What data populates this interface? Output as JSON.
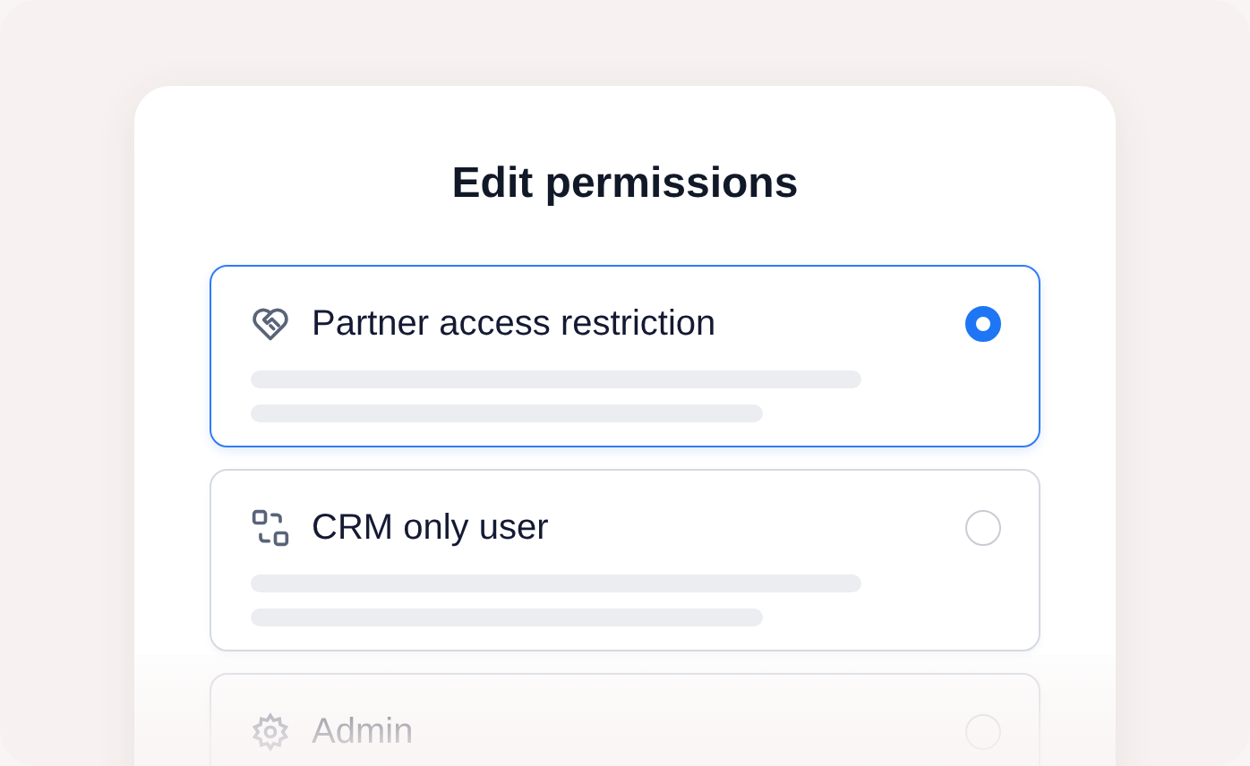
{
  "title": "Edit permissions",
  "options": [
    {
      "label": "Partner access restriction",
      "selected": true,
      "kind": "full"
    },
    {
      "label": "CRM only user",
      "selected": false,
      "kind": "full"
    },
    {
      "label": "Admin",
      "selected": false,
      "kind": "cut"
    }
  ]
}
